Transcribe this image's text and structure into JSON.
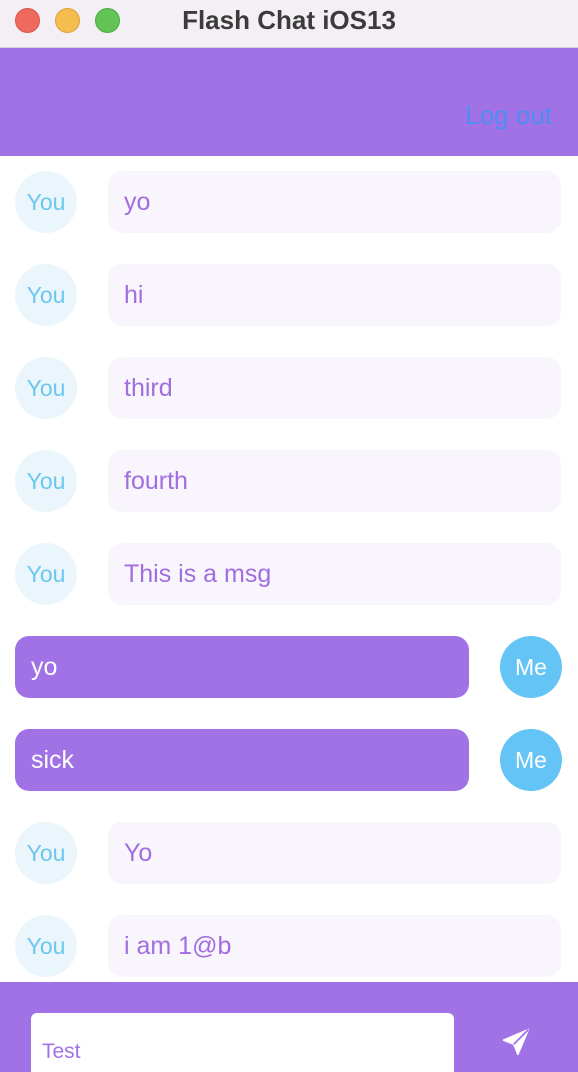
{
  "window": {
    "title": "Flash Chat iOS13"
  },
  "navbar": {
    "logout_label": "Log out"
  },
  "messages": [
    {
      "sender": "You",
      "text": "yo"
    },
    {
      "sender": "You",
      "text": "hi"
    },
    {
      "sender": "You",
      "text": "third"
    },
    {
      "sender": "You",
      "text": "fourth"
    },
    {
      "sender": "You",
      "text": "This is a msg"
    },
    {
      "sender": "Me",
      "text": "yo"
    },
    {
      "sender": "Me",
      "text": "sick"
    },
    {
      "sender": "You",
      "text": "Yo"
    },
    {
      "sender": "You",
      "text": "i am 1@b"
    }
  ],
  "composer": {
    "input_value": "Test",
    "send_icon": "paper-plane-icon"
  },
  "colors": {
    "accent": "#a172e6",
    "me_avatar": "#63c4f5",
    "you_avatar_bg": "#eaf6fb",
    "you_bubble_bg": "#f8f5fd",
    "link": "#4e8df2"
  }
}
